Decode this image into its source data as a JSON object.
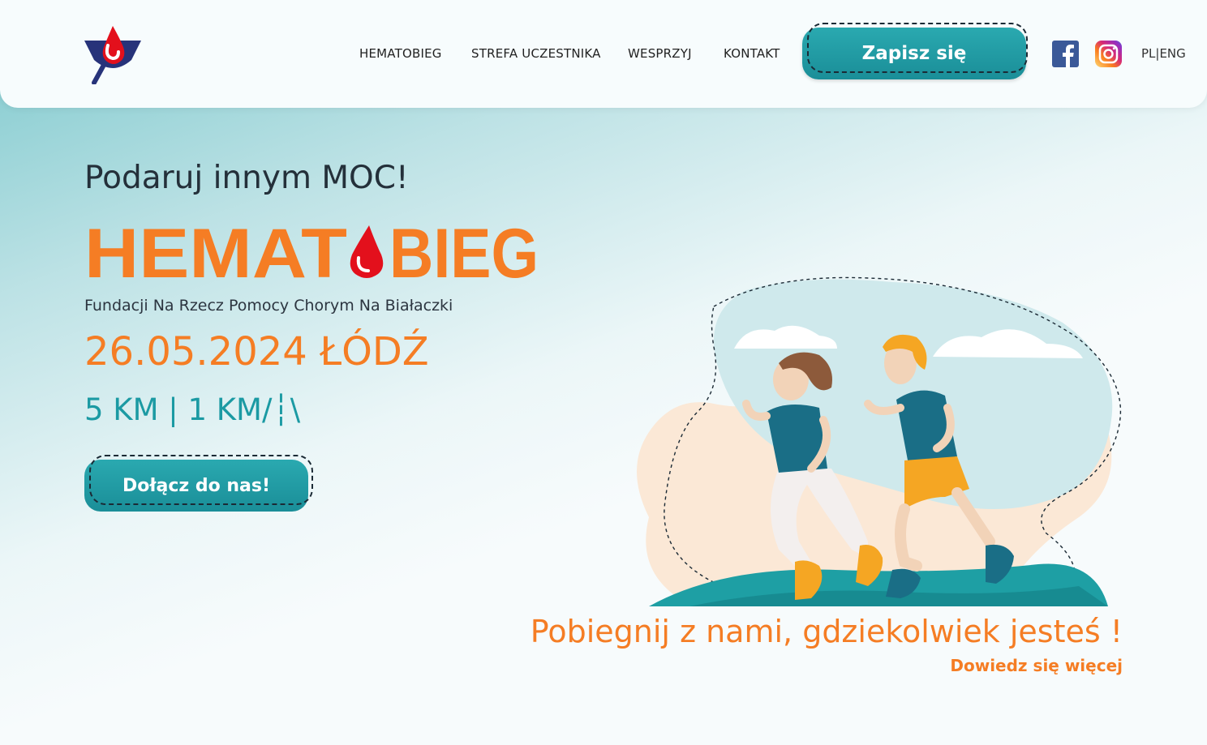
{
  "header": {
    "nav": [
      {
        "label": "HEMATOBIEG"
      },
      {
        "label": "STREFA UCZESTNIKA"
      },
      {
        "label": "WESPRZYJ"
      },
      {
        "label": "KONTAKT"
      }
    ],
    "signup_label": "Zapisz się",
    "lang": "PL|ENG",
    "social_icons": [
      "facebook-icon",
      "instagram-icon"
    ]
  },
  "hero": {
    "slogan": "Podaruj innym MOC!",
    "brand_left": "HEMAT",
    "brand_right": "BIEG",
    "foundation": "Fundacji Na Rzecz Pomocy Chorym Na Białaczki",
    "date": "26.05.2024 ŁÓDŹ",
    "distance": "5 KM | 1 KM/┆\\",
    "join_label": "Dołącz do nas!",
    "run_text": "Pobiegnij z nami, gdziekolwiek jesteś !",
    "more_label": "Dowiedz się więcej"
  },
  "colors": {
    "accent_orange": "#f57d24",
    "accent_teal": "#1b9aa3",
    "drop_red": "#e3101c",
    "logo_blue": "#27337a"
  }
}
